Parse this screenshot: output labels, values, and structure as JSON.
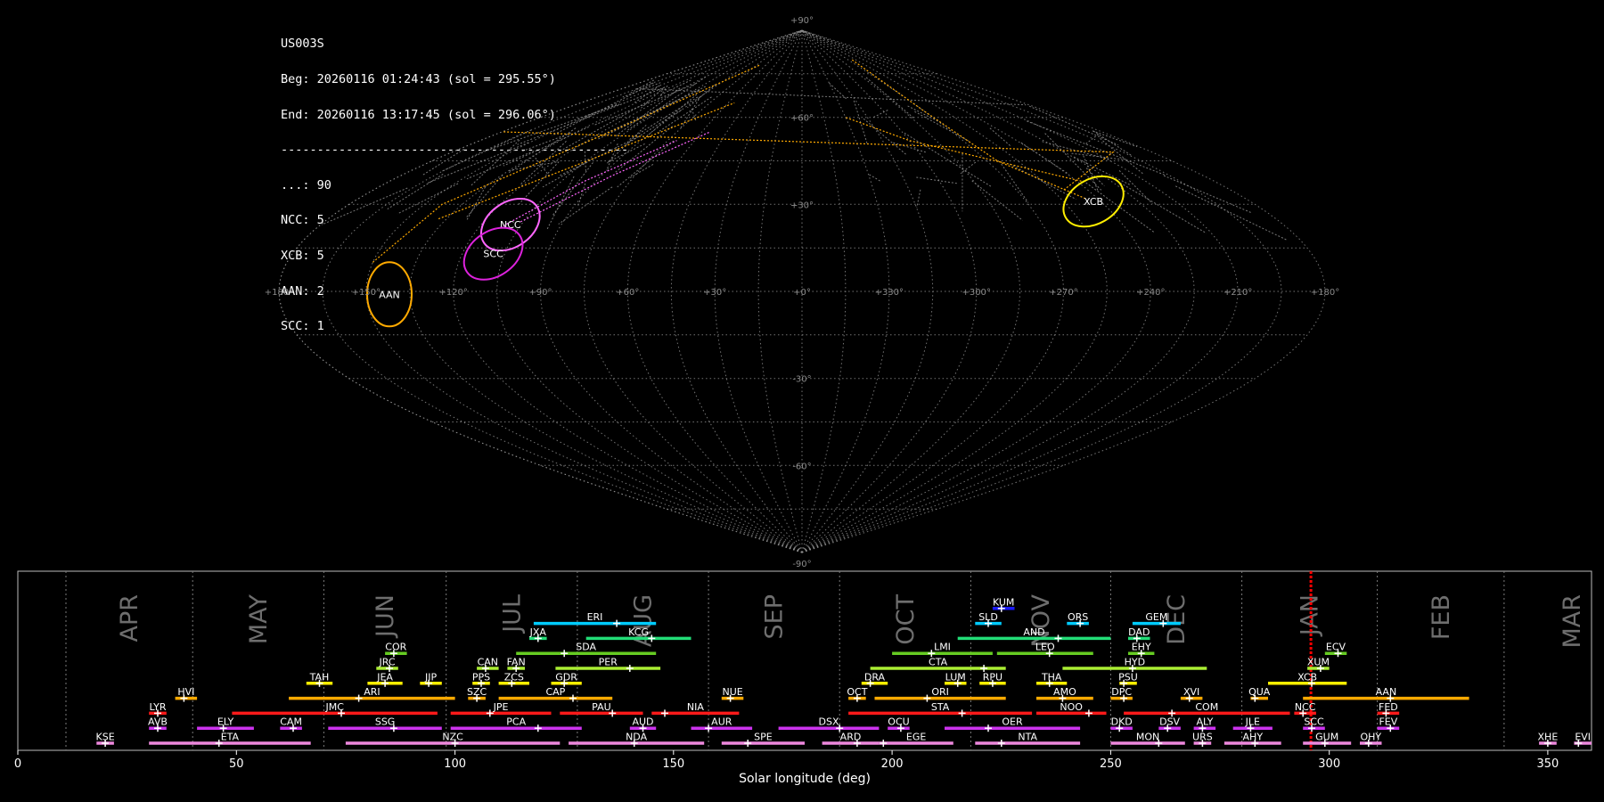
{
  "info": {
    "shower_code": "US003S",
    "begin": "Beg: 20260116 01:24:43 (sol = 295.55°)",
    "end": "End: 20260116 13:17:45 (sol = 296.06°)",
    "separator": "------------------------------------------------",
    "counts": [
      "...: 90",
      "NCC: 5",
      "XCB: 5",
      "AAN: 2",
      "SCC: 1"
    ]
  },
  "colors": {
    "background": "#000000",
    "grid": "#9a9a9a",
    "label_gray": "#8a8a8a",
    "month_label": "#6e6e6e",
    "current_sol": "#ff0000",
    "sporadic_trail": "#ffaa00"
  },
  "chart_data": [
    {
      "type": "scatter",
      "title": "",
      "projection": "sinusoidal sky map",
      "longitude_ticks": [
        "+180°",
        "+150°",
        "+120°",
        "+90°",
        "+60°",
        "+30°",
        "+0°",
        "+330°",
        "+300°",
        "+270°",
        "+240°",
        "+210°",
        "+180°"
      ],
      "latitude_ticks": [
        "+90°",
        "+60°",
        "+30°",
        "-30°",
        "-60°",
        "-90°"
      ],
      "grid": true,
      "radiants": [
        {
          "code": "NCC",
          "lon": 109,
          "lat": 23,
          "color": "#ff66ff"
        },
        {
          "code": "SCC",
          "lon": 109,
          "lat": 13,
          "color": "#dd22dd"
        },
        {
          "code": "XCB",
          "lon": 243,
          "lat": 31,
          "color": "#ffee00"
        },
        {
          "code": "AAN",
          "lon": 142,
          "lat": -1,
          "color": "#ffaa00"
        }
      ]
    },
    {
      "type": "timeline",
      "title": "",
      "xlabel": "Solar longitude (deg)",
      "xlim": [
        0,
        360
      ],
      "xticks": [
        0,
        50,
        100,
        150,
        200,
        250,
        300,
        350
      ],
      "grid": false,
      "current_sol": [
        295.55,
        296.06
      ],
      "months": [
        {
          "label": "APR",
          "start": 11,
          "end": 40
        },
        {
          "label": "MAY",
          "start": 40,
          "end": 70
        },
        {
          "label": "JUN",
          "start": 70,
          "end": 98
        },
        {
          "label": "JUL",
          "start": 98,
          "end": 128
        },
        {
          "label": "AUG",
          "start": 128,
          "end": 158
        },
        {
          "label": "SEP",
          "start": 158,
          "end": 188
        },
        {
          "label": "OCT",
          "start": 188,
          "end": 218
        },
        {
          "label": "NOV",
          "start": 218,
          "end": 250
        },
        {
          "label": "DEC",
          "start": 250,
          "end": 280
        },
        {
          "label": "JAN",
          "start": 280,
          "end": 311
        },
        {
          "label": "FEB",
          "start": 311,
          "end": 340
        },
        {
          "label": "MAR",
          "start": 340,
          "end": 371
        }
      ],
      "showers": [
        {
          "code": "KUM",
          "start": 223,
          "end": 228,
          "peak": 225,
          "row": 10,
          "color": "#1a1aff"
        },
        {
          "code": "ERI",
          "start": 118,
          "end": 146,
          "peak": 137,
          "row": 9,
          "color": "#00ccff"
        },
        {
          "code": "SLD",
          "start": 219,
          "end": 225,
          "peak": 222,
          "row": 9,
          "color": "#00ccff"
        },
        {
          "code": "ORS",
          "start": 240,
          "end": 245,
          "peak": 243,
          "row": 9,
          "color": "#00ccff"
        },
        {
          "code": "GEM",
          "start": 255,
          "end": 266,
          "peak": 262,
          "row": 9,
          "color": "#00ccff"
        },
        {
          "code": "JXA",
          "start": 117,
          "end": 121,
          "peak": 119,
          "row": 8,
          "color": "#22dd77"
        },
        {
          "code": "KCG",
          "start": 130,
          "end": 154,
          "peak": 145,
          "row": 8,
          "color": "#22dd77"
        },
        {
          "code": "AND",
          "start": 215,
          "end": 250,
          "peak": 238,
          "row": 8,
          "color": "#22dd77"
        },
        {
          "code": "DAD",
          "start": 254,
          "end": 259,
          "peak": 256,
          "row": 8,
          "color": "#22dd77"
        },
        {
          "code": "COR",
          "start": 84,
          "end": 89,
          "peak": 86,
          "row": 7,
          "color": "#66cc22"
        },
        {
          "code": "SDA",
          "start": 114,
          "end": 146,
          "peak": 125,
          "row": 7,
          "color": "#66cc22"
        },
        {
          "code": "LMI",
          "start": 200,
          "end": 223,
          "peak": 209,
          "row": 7,
          "color": "#66cc22"
        },
        {
          "code": "LEO",
          "start": 224,
          "end": 246,
          "peak": 236,
          "row": 7,
          "color": "#66cc22"
        },
        {
          "code": "EHY",
          "start": 254,
          "end": 260,
          "peak": 257,
          "row": 7,
          "color": "#66cc22"
        },
        {
          "code": "ECV",
          "start": 299,
          "end": 304,
          "peak": 302,
          "row": 7,
          "color": "#66cc22"
        },
        {
          "code": "JRC",
          "start": 82,
          "end": 87,
          "peak": 85,
          "row": 6,
          "color": "#aaee33"
        },
        {
          "code": "CAN",
          "start": 105,
          "end": 110,
          "peak": 107,
          "row": 6,
          "color": "#aaee33"
        },
        {
          "code": "FAN",
          "start": 112,
          "end": 116,
          "peak": 114,
          "row": 6,
          "color": "#aaee33"
        },
        {
          "code": "PER",
          "start": 123,
          "end": 147,
          "peak": 140,
          "row": 6,
          "color": "#aaee33"
        },
        {
          "code": "CTA",
          "start": 195,
          "end": 226,
          "peak": 221,
          "row": 6,
          "color": "#aaee33"
        },
        {
          "code": "HYD",
          "start": 239,
          "end": 272,
          "peak": 255,
          "row": 6,
          "color": "#aaee33"
        },
        {
          "code": "XUM",
          "start": 295,
          "end": 300,
          "peak": 298,
          "row": 6,
          "color": "#aaee33"
        },
        {
          "code": "TAH",
          "start": 66,
          "end": 72,
          "peak": 69,
          "row": 5,
          "color": "#ffee00"
        },
        {
          "code": "JEA",
          "start": 80,
          "end": 88,
          "peak": 84,
          "row": 5,
          "color": "#ffee00"
        },
        {
          "code": "JIP",
          "start": 92,
          "end": 97,
          "peak": 94,
          "row": 5,
          "color": "#ffee00"
        },
        {
          "code": "PPS",
          "start": 104,
          "end": 108,
          "peak": 106,
          "row": 5,
          "color": "#ffee00"
        },
        {
          "code": "ZCS",
          "start": 110,
          "end": 117,
          "peak": 113,
          "row": 5,
          "color": "#ffee00"
        },
        {
          "code": "GDR",
          "start": 122,
          "end": 129,
          "peak": 125,
          "row": 5,
          "color": "#ffee00"
        },
        {
          "code": "DRA",
          "start": 193,
          "end": 199,
          "peak": 195,
          "row": 5,
          "color": "#ffee00"
        },
        {
          "code": "LUM",
          "start": 212,
          "end": 217,
          "peak": 215,
          "row": 5,
          "color": "#ffee00"
        },
        {
          "code": "RPU",
          "start": 220,
          "end": 226,
          "peak": 223,
          "row": 5,
          "color": "#ffee00"
        },
        {
          "code": "THA",
          "start": 233,
          "end": 240,
          "peak": 236,
          "row": 5,
          "color": "#ffee00"
        },
        {
          "code": "PSU",
          "start": 252,
          "end": 256,
          "peak": 253,
          "row": 5,
          "color": "#ffee00"
        },
        {
          "code": "XCB",
          "start": 286,
          "end": 304,
          "peak": 296,
          "row": 5,
          "color": "#ffee00"
        },
        {
          "code": "HVI",
          "start": 36,
          "end": 41,
          "peak": 38,
          "row": 4,
          "color": "#ffaa00"
        },
        {
          "code": "ARI",
          "start": 62,
          "end": 100,
          "peak": 78,
          "row": 4,
          "color": "#ffaa00"
        },
        {
          "code": "SZC",
          "start": 103,
          "end": 107,
          "peak": 105,
          "row": 4,
          "color": "#ffaa00"
        },
        {
          "code": "CAP",
          "start": 110,
          "end": 136,
          "peak": 127,
          "row": 4,
          "color": "#ffaa00"
        },
        {
          "code": "NUE",
          "start": 161,
          "end": 166,
          "peak": 163,
          "row": 4,
          "color": "#ffaa00"
        },
        {
          "code": "OCT",
          "start": 190,
          "end": 194,
          "peak": 192,
          "row": 4,
          "color": "#ffaa00"
        },
        {
          "code": "ORI",
          "start": 196,
          "end": 226,
          "peak": 208,
          "row": 4,
          "color": "#ffaa00"
        },
        {
          "code": "AMO",
          "start": 233,
          "end": 246,
          "peak": 239,
          "row": 4,
          "color": "#ffaa00"
        },
        {
          "code": "DPC",
          "start": 250,
          "end": 255,
          "peak": 253,
          "row": 4,
          "color": "#ffaa00"
        },
        {
          "code": "XVI",
          "start": 266,
          "end": 271,
          "peak": 268,
          "row": 4,
          "color": "#ffaa00"
        },
        {
          "code": "QUA",
          "start": 282,
          "end": 286,
          "peak": 283,
          "row": 4,
          "color": "#ffaa00"
        },
        {
          "code": "AAN",
          "start": 294,
          "end": 332,
          "peak": 314,
          "row": 4,
          "color": "#ffaa00"
        },
        {
          "code": "LYR",
          "start": 30,
          "end": 34,
          "peak": 32,
          "row": 3,
          "color": "#ff1a1a"
        },
        {
          "code": "JMC",
          "start": 49,
          "end": 96,
          "peak": 74,
          "row": 3,
          "color": "#ff1a1a"
        },
        {
          "code": "JPE",
          "start": 99,
          "end": 122,
          "peak": 108,
          "row": 3,
          "color": "#ff1a1a"
        },
        {
          "code": "PAU",
          "start": 124,
          "end": 143,
          "peak": 136,
          "row": 3,
          "color": "#ff1a1a"
        },
        {
          "code": "NIA",
          "start": 145,
          "end": 165,
          "peak": 148,
          "row": 3,
          "color": "#ff1a1a"
        },
        {
          "code": "STA",
          "start": 190,
          "end": 232,
          "peak": 216,
          "row": 3,
          "color": "#ff1a1a"
        },
        {
          "code": "NOO",
          "start": 233,
          "end": 249,
          "peak": 245,
          "row": 3,
          "color": "#ff1a1a"
        },
        {
          "code": "COM",
          "start": 253,
          "end": 291,
          "peak": 264,
          "row": 3,
          "color": "#ff1a1a"
        },
        {
          "code": "NCC",
          "start": 292,
          "end": 297,
          "peak": 294,
          "row": 3,
          "color": "#ff1a1a"
        },
        {
          "code": "FED",
          "start": 311,
          "end": 316,
          "peak": 313,
          "row": 3,
          "color": "#ff1a1a"
        },
        {
          "code": "AVB",
          "start": 30,
          "end": 34,
          "peak": 32,
          "row": 2,
          "color": "#cc33ee"
        },
        {
          "code": "ELY",
          "start": 41,
          "end": 54,
          "peak": 47,
          "row": 2,
          "color": "#cc33ee"
        },
        {
          "code": "CAM",
          "start": 60,
          "end": 65,
          "peak": 63,
          "row": 2,
          "color": "#cc33ee"
        },
        {
          "code": "SSG",
          "start": 71,
          "end": 97,
          "peak": 86,
          "row": 2,
          "color": "#cc33ee"
        },
        {
          "code": "PCA",
          "start": 99,
          "end": 129,
          "peak": 119,
          "row": 2,
          "color": "#cc33ee"
        },
        {
          "code": "AUD",
          "start": 140,
          "end": 146,
          "peak": 143,
          "row": 2,
          "color": "#cc33ee"
        },
        {
          "code": "AUR",
          "start": 154,
          "end": 168,
          "peak": 158,
          "row": 2,
          "color": "#cc33ee"
        },
        {
          "code": "DSX",
          "start": 174,
          "end": 197,
          "peak": 188,
          "row": 2,
          "color": "#cc33ee"
        },
        {
          "code": "OCU",
          "start": 199,
          "end": 204,
          "peak": 202,
          "row": 2,
          "color": "#cc33ee"
        },
        {
          "code": "OER",
          "start": 212,
          "end": 243,
          "peak": 222,
          "row": 2,
          "color": "#cc33ee"
        },
        {
          "code": "DKD",
          "start": 250,
          "end": 255,
          "peak": 252,
          "row": 2,
          "color": "#cc33ee"
        },
        {
          "code": "DSV",
          "start": 261,
          "end": 266,
          "peak": 263,
          "row": 2,
          "color": "#cc33ee"
        },
        {
          "code": "ALY",
          "start": 269,
          "end": 274,
          "peak": 271,
          "row": 2,
          "color": "#cc33ee"
        },
        {
          "code": "JLE",
          "start": 278,
          "end": 287,
          "peak": 282,
          "row": 2,
          "color": "#cc33ee"
        },
        {
          "code": "SCC",
          "start": 294,
          "end": 299,
          "peak": 296,
          "row": 2,
          "color": "#cc33ee"
        },
        {
          "code": "FEV",
          "start": 311,
          "end": 316,
          "peak": 314,
          "row": 2,
          "color": "#cc33ee"
        },
        {
          "code": "KSE",
          "start": 18,
          "end": 22,
          "peak": 20,
          "row": 1,
          "color": "#ee88dd"
        },
        {
          "code": "ETA",
          "start": 30,
          "end": 67,
          "peak": 46,
          "row": 1,
          "color": "#ee88dd"
        },
        {
          "code": "NZC",
          "start": 75,
          "end": 124,
          "peak": 100,
          "row": 1,
          "color": "#ee88dd"
        },
        {
          "code": "NDA",
          "start": 126,
          "end": 157,
          "peak": 141,
          "row": 1,
          "color": "#ee88dd"
        },
        {
          "code": "SPE",
          "start": 161,
          "end": 180,
          "peak": 167,
          "row": 1,
          "color": "#ee88dd"
        },
        {
          "code": "ARD",
          "start": 184,
          "end": 197,
          "peak": 192,
          "row": 1,
          "color": "#ee88dd"
        },
        {
          "code": "EGE",
          "start": 197,
          "end": 214,
          "peak": 198,
          "row": 1,
          "color": "#ee88dd"
        },
        {
          "code": "NTA",
          "start": 219,
          "end": 243,
          "peak": 225,
          "row": 1,
          "color": "#ee88dd"
        },
        {
          "code": "MON",
          "start": 250,
          "end": 267,
          "peak": 261,
          "row": 1,
          "color": "#ee88dd"
        },
        {
          "code": "URS",
          "start": 269,
          "end": 273,
          "peak": 271,
          "row": 1,
          "color": "#ee88dd"
        },
        {
          "code": "AHY",
          "start": 276,
          "end": 289,
          "peak": 283,
          "row": 1,
          "color": "#ee88dd"
        },
        {
          "code": "GUM",
          "start": 294,
          "end": 305,
          "peak": 299,
          "row": 1,
          "color": "#ee88dd"
        },
        {
          "code": "OHY",
          "start": 307,
          "end": 312,
          "peak": 309,
          "row": 1,
          "color": "#ee88dd"
        },
        {
          "code": "XHE",
          "start": 348,
          "end": 352,
          "peak": 350,
          "row": 1,
          "color": "#ee88dd"
        },
        {
          "code": "EVI",
          "start": 356,
          "end": 360,
          "peak": 357,
          "row": 1,
          "color": "#ee88dd"
        }
      ]
    }
  ]
}
